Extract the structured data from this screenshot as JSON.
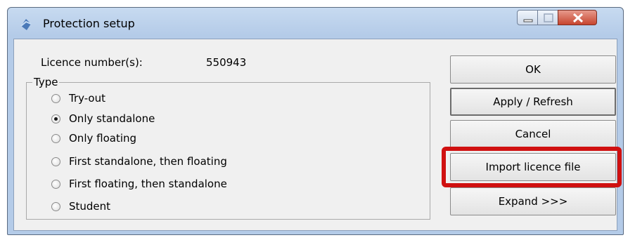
{
  "window": {
    "title": "Protection setup"
  },
  "licence": {
    "label": "Licence number(s):",
    "value": "550943"
  },
  "type_group": {
    "legend": "Type",
    "options": [
      {
        "label": "Try-out",
        "checked": false
      },
      {
        "label": "Only standalone",
        "checked": true
      },
      {
        "label": "Only floating",
        "checked": false
      },
      {
        "label": "First standalone, then floating",
        "checked": false
      },
      {
        "label": "First floating, then standalone",
        "checked": false
      },
      {
        "label": "Student",
        "checked": false
      }
    ]
  },
  "buttons": {
    "ok": "OK",
    "apply_refresh": "Apply / Refresh",
    "cancel": "Cancel",
    "import_licence": "Import licence file",
    "expand": "Expand >>>"
  },
  "colors": {
    "highlight": "#d01010",
    "window_frame": "#b4cbe8",
    "client_bg": "#f0f0f0"
  }
}
